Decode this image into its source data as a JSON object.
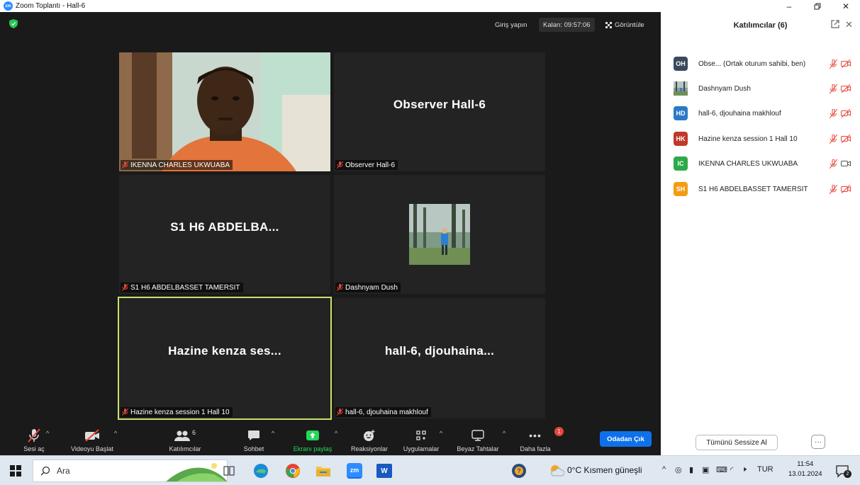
{
  "window": {
    "title": "Zoom Toplantı - Hall-6",
    "logo_text": "zm"
  },
  "topbar": {
    "signin": "Giriş yapın",
    "remaining": "Kalan: 09:57:06",
    "view": "Görüntüle"
  },
  "tiles": [
    {
      "big": "",
      "label": "IKENNA CHARLES UKWUABA",
      "kind": "video"
    },
    {
      "big": "Observer Hall-6",
      "label": "Observer Hall-6",
      "kind": "name"
    },
    {
      "big": "S1 H6 ABDELBA...",
      "label": "S1 H6 ABDELBASSET TAMERSIT",
      "kind": "name"
    },
    {
      "big": "",
      "label": "Dashnyam Dush",
      "kind": "photo"
    },
    {
      "big": "Hazine kenza ses...",
      "label": "Hazine kenza session 1 Hall 10",
      "kind": "name",
      "active": true
    },
    {
      "big": "hall-6, djouhaina...",
      "label": "hall-6, djouhaina makhlouf",
      "kind": "name"
    }
  ],
  "toolbar": {
    "unmute": "Sesi aç",
    "start_video": "Videoyu Başlat",
    "participants": "Katılımcılar",
    "participants_count": "6",
    "chat": "Sohbet",
    "share": "Ekranı paylaş",
    "reactions": "Reaksiyonlar",
    "apps": "Uygulamalar",
    "whiteboards": "Beyaz Tahtalar",
    "more": "Daha fazla",
    "more_badge": "1",
    "leave": "Odadan Çık"
  },
  "panel": {
    "title": "Katılımcılar (6)",
    "participants": [
      {
        "initials": "OH",
        "name": "Obse... (Ortak oturum sahibi, ben)",
        "color": "#3a4a5c",
        "video": "off"
      },
      {
        "initials": "",
        "name": "Dashnyam Dush",
        "color": "#7a8a99",
        "video": "off"
      },
      {
        "initials": "HD",
        "name": "hall-6, djouhaina makhlouf",
        "color": "#2a7ac7",
        "video": "off"
      },
      {
        "initials": "HK",
        "name": "Hazine kenza session 1 Hall 10",
        "color": "#c0392b",
        "video": "off"
      },
      {
        "initials": "IC",
        "name": "IKENNA CHARLES UKWUABA",
        "color": "#2eaa4a",
        "video": "on"
      },
      {
        "initials": "SH",
        "name": "S1 H6 ABDELBASSET TAMERSIT",
        "color": "#f39c12",
        "video": "off"
      }
    ],
    "mute_all": "Tümünü Sessize Al",
    "more": "···"
  },
  "taskbar": {
    "search": "Ara",
    "weather": "0°C  Kısmen güneşli",
    "lang": "TUR",
    "time": "11:54",
    "date": "13.01.2024",
    "notif": "2"
  },
  "colors": {
    "accent": "#0e71eb",
    "share_green": "#23d959",
    "active_border": "#c8e36b",
    "muted_red": "#e8463a"
  }
}
